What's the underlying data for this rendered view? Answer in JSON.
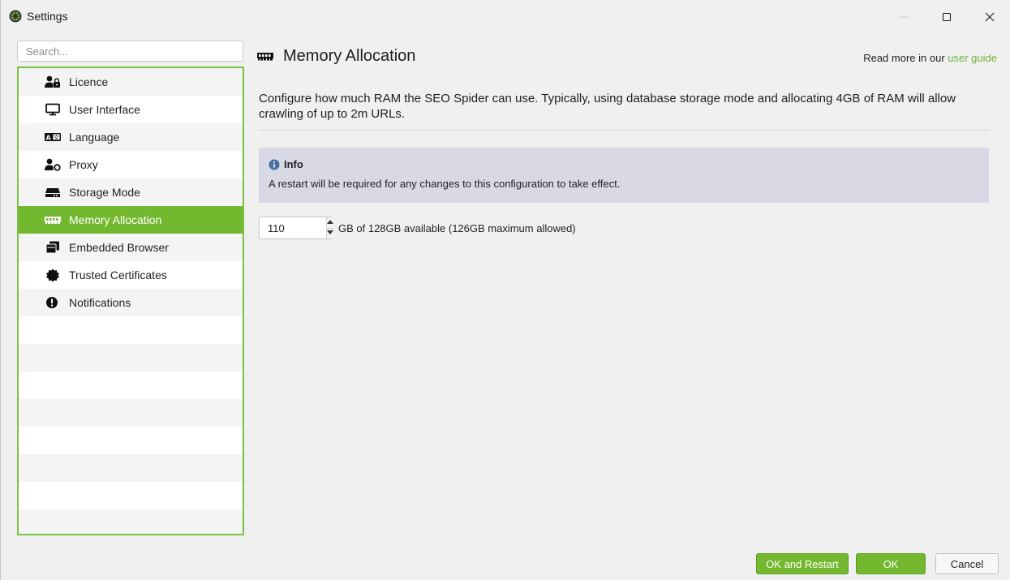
{
  "window": {
    "title": "Settings",
    "app_icon": "spider-icon",
    "controls": [
      "minimize-icon",
      "maximize-icon",
      "close-icon"
    ]
  },
  "sidebar": {
    "search_placeholder": "Search...",
    "items": [
      {
        "label": "Licence",
        "icon": "user-lock-icon"
      },
      {
        "label": "User Interface",
        "icon": "monitor-icon"
      },
      {
        "label": "Language",
        "icon": "language-icon"
      },
      {
        "label": "Proxy",
        "icon": "user-proxy-icon"
      },
      {
        "label": "Storage Mode",
        "icon": "hard-drive-icon"
      },
      {
        "label": "Memory Allocation",
        "icon": "memory-icon",
        "selected": true
      },
      {
        "label": "Embedded Browser",
        "icon": "browser-windows-icon"
      },
      {
        "label": "Trusted Certificates",
        "icon": "certificate-icon"
      },
      {
        "label": "Notifications",
        "icon": "exclamation-icon"
      }
    ]
  },
  "main": {
    "title": "Memory Allocation",
    "title_icon": "memory-icon",
    "guide_prefix": "Read more in our",
    "guide_link": "user guide",
    "description": "Configure how much RAM the SEO Spider can use. Typically, using database storage mode and allocating 4GB of RAM will allow crawling of up to 2m URLs.",
    "info": {
      "title": "Info",
      "text": "A restart will be required for any changes to this configuration to take effect."
    },
    "memory": {
      "value": "110",
      "label": "GB of 128GB available (126GB maximum allowed)"
    }
  },
  "footer": {
    "ok_restart": "OK and Restart",
    "ok": "OK",
    "cancel": "Cancel"
  },
  "colors": {
    "accent": "#74b82f",
    "nav_border": "#7cc243",
    "link": "#6cb33e",
    "info_bg": "#d9d9e6"
  }
}
